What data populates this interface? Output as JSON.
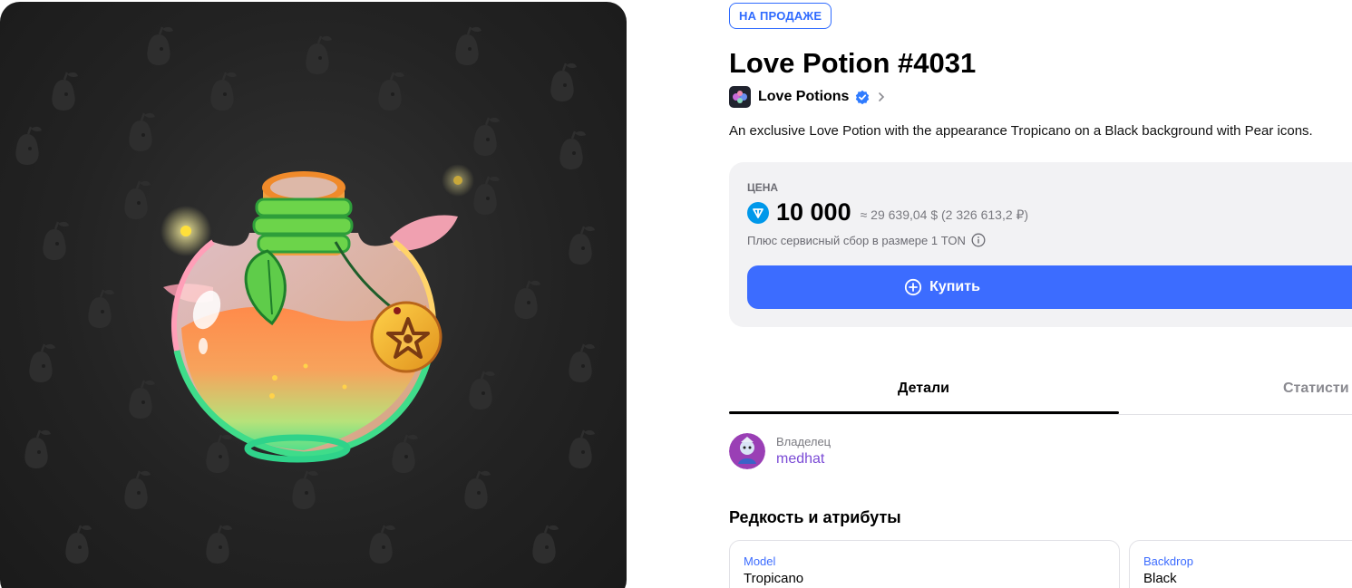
{
  "badge": "НА ПРОДАЖЕ",
  "title": "Love Potion #4031",
  "collection": {
    "name": "Love Potions",
    "icon": "collection-avatar",
    "verified_icon": "verified-check-icon"
  },
  "description": "An exclusive Love Potion with the appearance Tropicano on a Black background with Pear icons.",
  "price": {
    "label": "ЦЕНА",
    "currency_icon": "ton-icon",
    "value": "10 000",
    "conversion": "≈ 29 639,04 $ (2 326 613,2 ₽)",
    "fee": "Плюс сервисный сбор в размере 1 TON"
  },
  "buy_button": {
    "label": "Купить",
    "icon": "plus-circle-icon"
  },
  "tabs": [
    {
      "label": "Детали",
      "active": true
    },
    {
      "label": "Статисти",
      "active": false
    }
  ],
  "owner": {
    "label": "Владелец",
    "name": "medhat"
  },
  "attributes_title": "Редкость и атрибуты",
  "attributes": [
    {
      "label": "Model",
      "value": "Tropicano"
    },
    {
      "label": "Backdrop",
      "value": "Black"
    }
  ],
  "colors": {
    "accent": "#3c6cff",
    "badge": "#2f6bff",
    "owner_link": "#7b4bd6",
    "card_bg": "#f2f2f4",
    "art_bg": "#232323"
  }
}
